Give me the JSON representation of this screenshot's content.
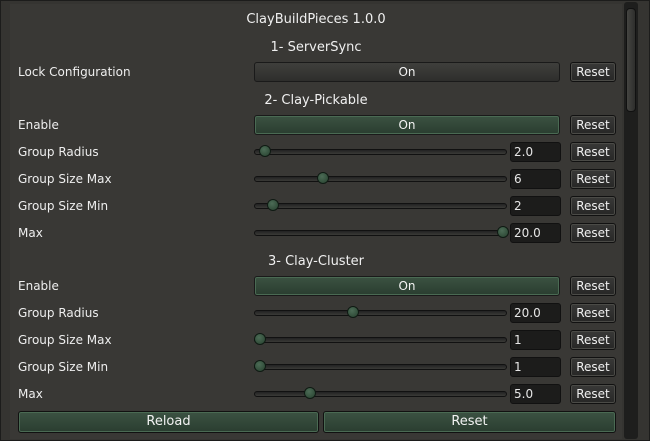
{
  "window": {
    "title": "ClayBuildPieces 1.0.0"
  },
  "sections": [
    {
      "title": "1- ServerSync",
      "rows": [
        {
          "label": "Lock Configuration",
          "kind": "toggle",
          "value": "On",
          "reset": "Reset"
        }
      ]
    },
    {
      "title": "2- Clay-Pickable",
      "rows": [
        {
          "label": "Enable",
          "kind": "toggle",
          "value": "On",
          "reset": "Reset"
        },
        {
          "label": "Group Radius",
          "kind": "slider",
          "value": "2.0",
          "fraction": 0.04,
          "reset": "Reset"
        },
        {
          "label": "Group Size Max",
          "kind": "slider",
          "value": "6",
          "fraction": 0.27,
          "reset": "Reset"
        },
        {
          "label": "Group Size Min",
          "kind": "slider",
          "value": "2",
          "fraction": 0.07,
          "reset": "Reset"
        },
        {
          "label": "Max",
          "kind": "slider",
          "value": "20.0",
          "fraction": 0.99,
          "reset": "Reset"
        }
      ]
    },
    {
      "title": "3- Clay-Cluster",
      "rows": [
        {
          "label": "Enable",
          "kind": "toggle",
          "value": "On",
          "reset": "Reset"
        },
        {
          "label": "Group Radius",
          "kind": "slider",
          "value": "20.0",
          "fraction": 0.39,
          "reset": "Reset"
        },
        {
          "label": "Group Size Max",
          "kind": "slider",
          "value": "1",
          "fraction": 0.02,
          "reset": "Reset"
        },
        {
          "label": "Group Size Min",
          "kind": "slider",
          "value": "1",
          "fraction": 0.02,
          "reset": "Reset"
        },
        {
          "label": "Max",
          "kind": "slider",
          "value": "5.0",
          "fraction": 0.22,
          "reset": "Reset"
        }
      ]
    }
  ],
  "footer": {
    "reload_label": "Reload",
    "reset_label": "Reset"
  },
  "colors": {
    "accent": "#2f4536",
    "panel": "#393835",
    "background": "#2b2a28"
  }
}
